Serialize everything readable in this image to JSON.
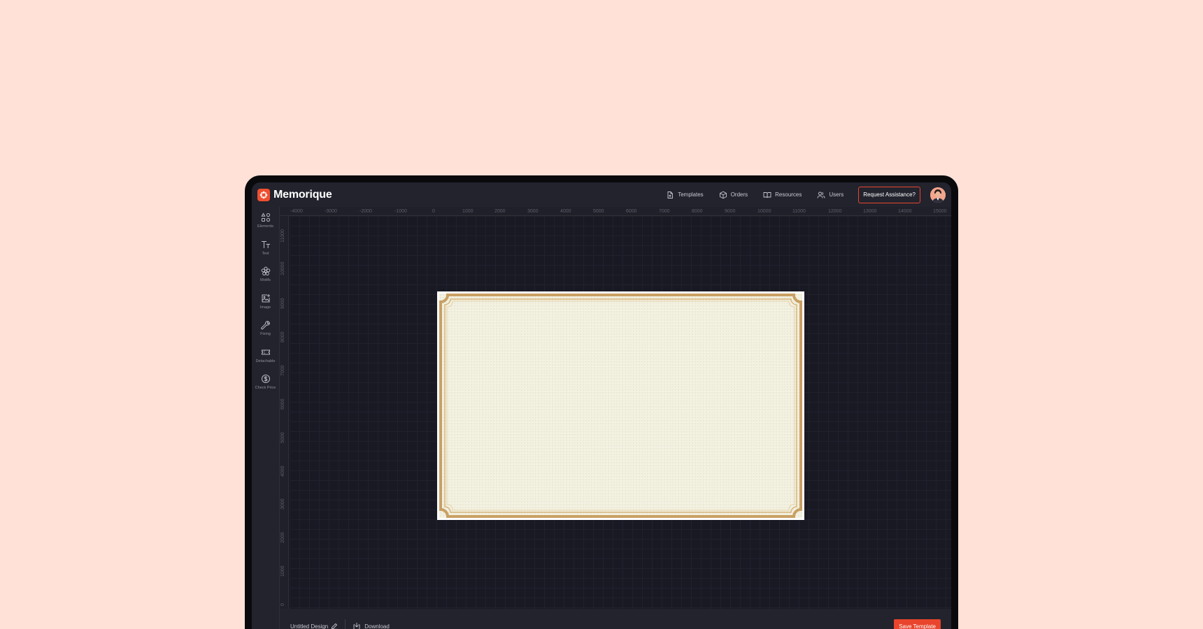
{
  "app": {
    "name": "Memorique"
  },
  "nav": {
    "items": [
      {
        "label": "Templates",
        "icon": "file-icon"
      },
      {
        "label": "Orders",
        "icon": "box-icon"
      },
      {
        "label": "Resources",
        "icon": "book-icon"
      },
      {
        "label": "Users",
        "icon": "users-icon"
      }
    ],
    "assist_label": "Request Assistance?"
  },
  "sidebar": {
    "items": [
      {
        "label": "Elements",
        "icon": "shapes-icon"
      },
      {
        "label": "Text",
        "icon": "text-icon"
      },
      {
        "label": "Motifs",
        "icon": "flower-icon"
      },
      {
        "label": "Image",
        "icon": "image-add-icon"
      },
      {
        "label": "Fixing",
        "icon": "wrench-icon"
      },
      {
        "label": "Detachable",
        "icon": "ticket-icon"
      },
      {
        "label": "Check Price",
        "icon": "dollar-icon"
      }
    ]
  },
  "ruler": {
    "horizontal": [
      "-4000",
      "-3000",
      "-2000",
      "-1000",
      "0",
      "1000",
      "2000",
      "3000",
      "4000",
      "5000",
      "6000",
      "7000",
      "8000",
      "9000",
      "10000",
      "11000",
      "12000",
      "13000",
      "14000",
      "15000"
    ],
    "vertical": [
      "11000",
      "10000",
      "9000",
      "8000",
      "7000",
      "6000",
      "5000",
      "4000",
      "3000",
      "2000",
      "1000",
      "0"
    ]
  },
  "footer": {
    "design_name": "Untitled Design",
    "download_label": "Download",
    "save_label": "Save Template"
  },
  "colors": {
    "accent": "#e8452c",
    "background": "#ffe1d8",
    "panel": "#22232d",
    "canvas": "#181923",
    "frame_gold": "#c9a064",
    "card_cream": "#f2f0df"
  }
}
